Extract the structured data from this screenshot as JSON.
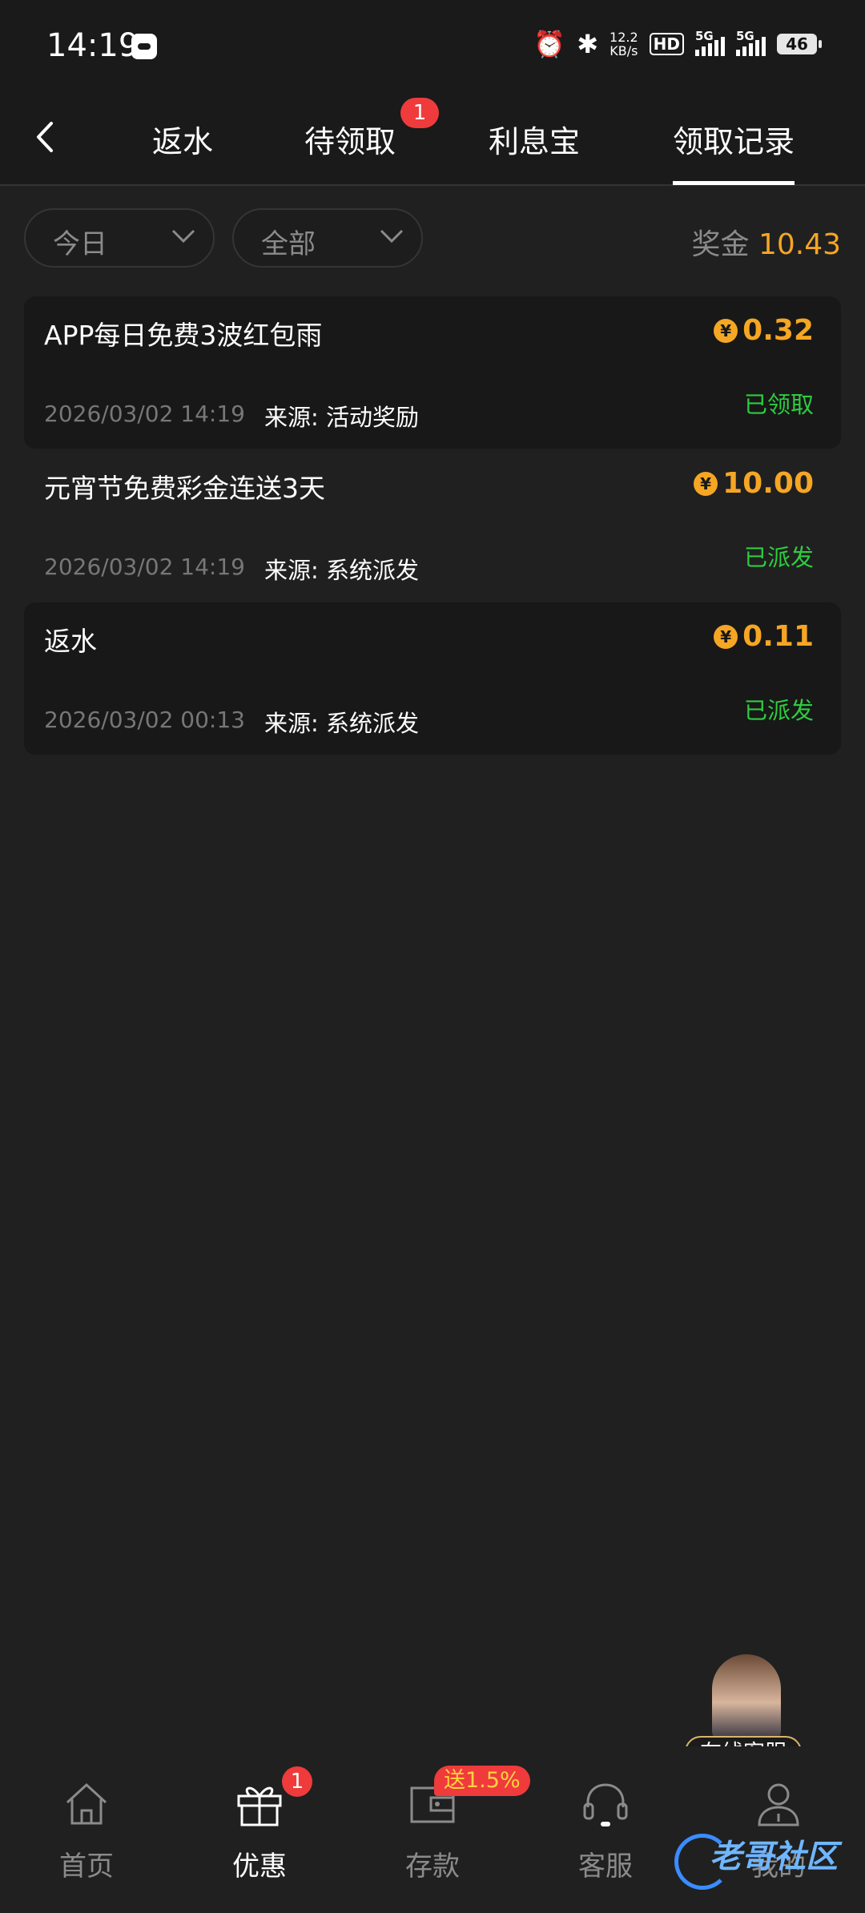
{
  "status_bar": {
    "time": "14:19",
    "network_speed_value": "12.2",
    "network_speed_unit": "KB/s",
    "hd_label": "HD",
    "signal_1_label": "5G",
    "signal_2_label": "5G",
    "battery": "46"
  },
  "nav": {
    "tabs": [
      {
        "label": "返水"
      },
      {
        "label": "待领取",
        "badge": "1"
      },
      {
        "label": "利息宝"
      },
      {
        "label": "领取记录"
      }
    ],
    "active_tab": "领取记录"
  },
  "filters": {
    "date_filter": "今日",
    "type_filter": "全部",
    "bonus_label": "奖金",
    "bonus_amount": "10.43"
  },
  "records": [
    {
      "title": "APP每日免费3波红包雨",
      "amount": "0.32",
      "date": "2026/03/02 14:19",
      "source": "来源: 活动奖励",
      "status": "已领取"
    },
    {
      "title": "元宵节免费彩金连送3天",
      "amount": "10.00",
      "date": "2026/03/02 14:19",
      "source": "来源: 系统派发",
      "status": "已派发"
    },
    {
      "title": "返水",
      "amount": "0.11",
      "date": "2026/03/02 00:13",
      "source": "来源: 系统派发",
      "status": "已派发"
    }
  ],
  "currency_symbol": "¥",
  "customer_service_widget": {
    "label": "在线客服"
  },
  "bottom_nav": {
    "items": [
      {
        "label": "首页",
        "icon": "home-icon"
      },
      {
        "label": "优惠",
        "icon": "gift-icon",
        "badge": "1"
      },
      {
        "label": "存款",
        "icon": "wallet-icon",
        "promo": "送1.5%"
      },
      {
        "label": "客服",
        "icon": "headset-icon"
      },
      {
        "label": "我的",
        "icon": "user-icon"
      }
    ],
    "active": "优惠"
  },
  "watermark": {
    "text": "老哥社区"
  },
  "colors": {
    "background": "#202020",
    "accent": "#f5a623",
    "success": "#2ecc40",
    "badge": "#ef3b3b"
  }
}
